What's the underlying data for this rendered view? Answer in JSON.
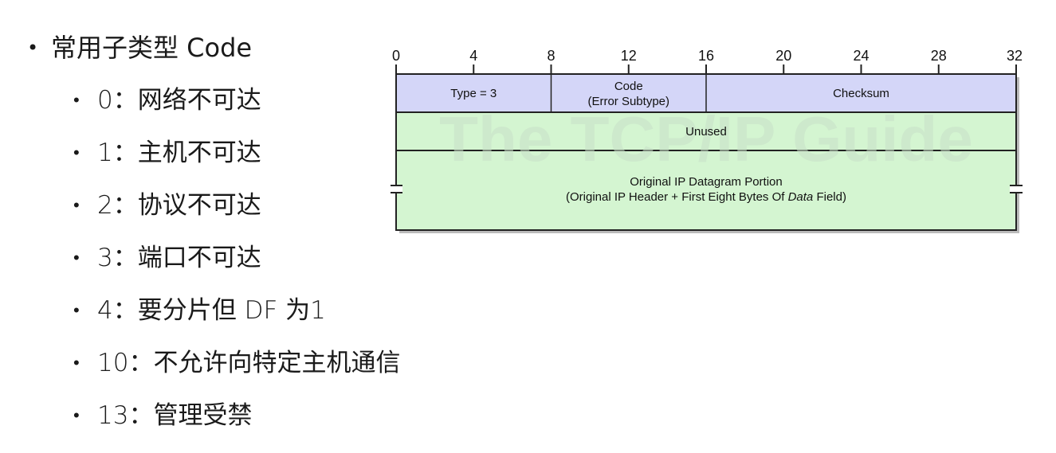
{
  "list": {
    "heading": "常用子类型 Code",
    "bullet": "•",
    "items": [
      "0：网络不可达",
      "1：主机不可达",
      "2：协议不可达",
      "3：端口不可达",
      "4：要分片但 DF 为1",
      "10：不允许向特定主机通信",
      "13：管理受禁"
    ]
  },
  "diagram": {
    "ruler_ticks": [
      "0",
      "4",
      "8",
      "12",
      "16",
      "20",
      "24",
      "28",
      "32"
    ],
    "watermark": "The TCP/IP Guide",
    "fields": {
      "type": "Type = 3",
      "code_line1": "Code",
      "code_line2": "(Error Subtype)",
      "checksum": "Checksum",
      "unused": "Unused",
      "original_line1": "Original IP Datagram Portion",
      "original_line2_a": "(Original IP Header + First Eight Bytes Of ",
      "original_line2_b": "Data",
      "original_line2_c": " Field)"
    },
    "colors": {
      "header_row": "#d4d6f8",
      "body_rows": "#d4f5d1",
      "border": "#222222"
    }
  }
}
